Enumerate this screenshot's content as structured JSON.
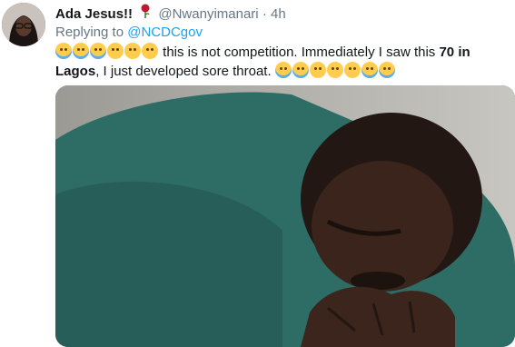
{
  "tweet": {
    "display_name": "Ada Jesus!!",
    "handle": "@Nwanyimanari",
    "separator": "·",
    "time": "4h",
    "name_emoji": "rose-emoji",
    "replying_prefix": "Replying to",
    "replying_to": "@NCDCgov",
    "text_part1": "this is not competition. Immediately I saw this",
    "text_bold1": "70 in",
    "text_bold2": "Lagos",
    "text_part2": ", I just developed sore throat.",
    "lead_emojis": [
      "sob",
      "sob",
      "sob",
      "cry",
      "cry",
      "cry"
    ],
    "trail_emojis": [
      "sob",
      "sob",
      "cry",
      "cry",
      "cry",
      "sob",
      "sob"
    ],
    "media": {
      "icon": "photo-crying-man"
    },
    "colors": {
      "link": "#1da1f2",
      "muted": "#657786",
      "text": "#14171a"
    }
  }
}
